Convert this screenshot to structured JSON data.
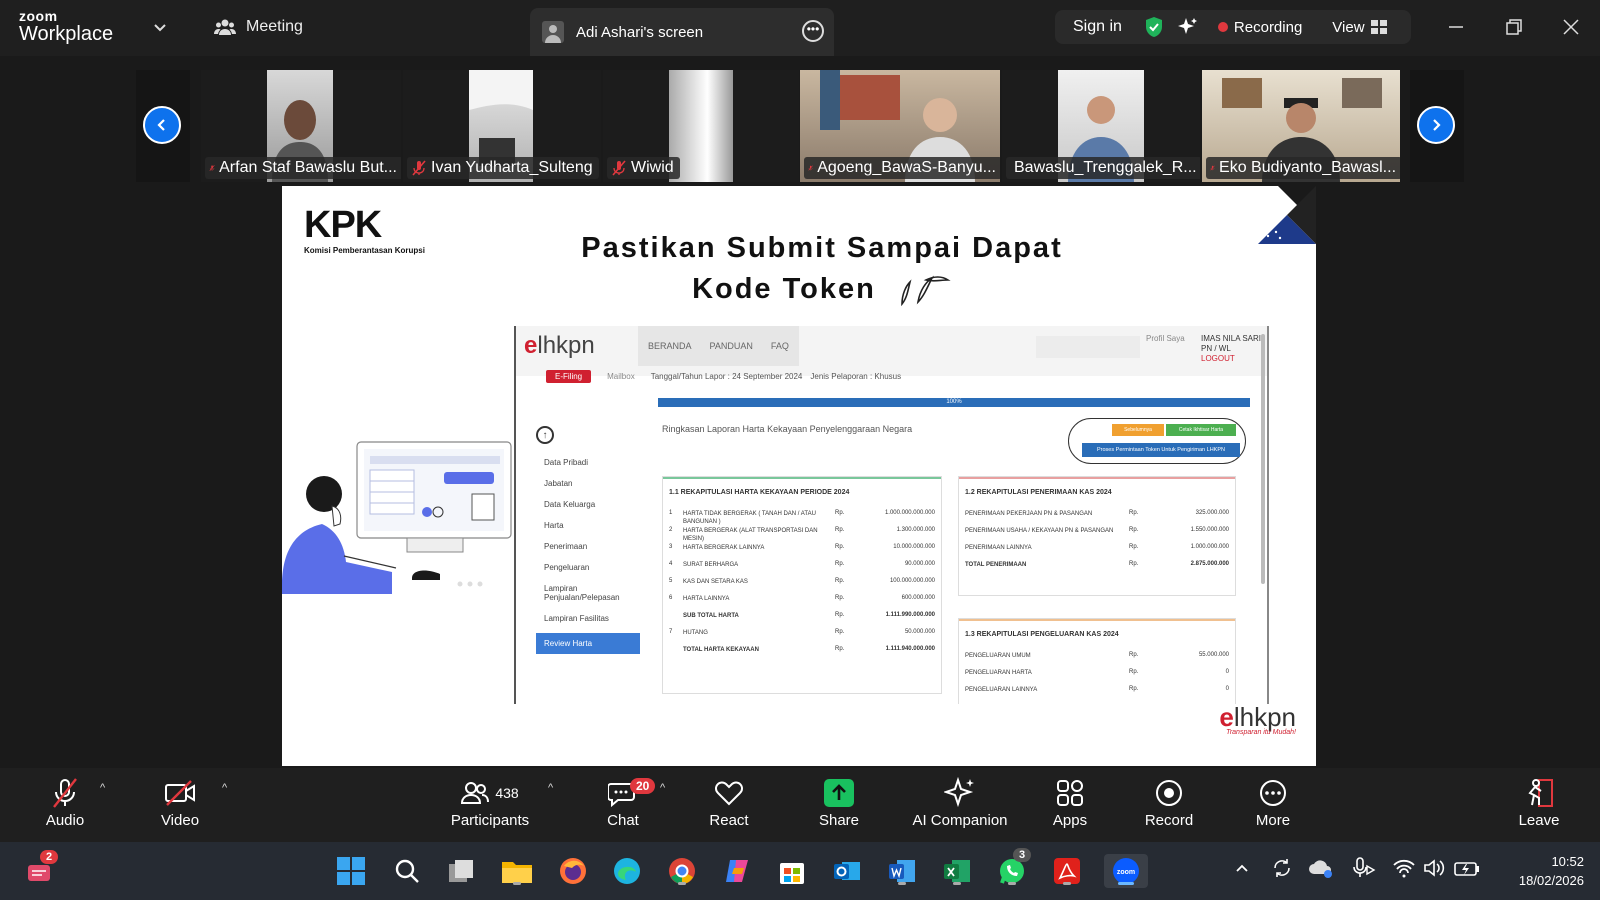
{
  "app": {
    "brand_top": "zoom",
    "brand_bottom": "Workplace"
  },
  "topbar": {
    "meeting_label": "Meeting",
    "screen_tab_label": "Adi Ashari's screen",
    "sign_in": "Sign in",
    "recording": "Recording",
    "view": "View"
  },
  "participants_strip": [
    {
      "name": "Arfan Staf Bawaslu But..."
    },
    {
      "name": "Ivan Yudharta_Sulteng"
    },
    {
      "name": "Wiwid"
    },
    {
      "name": "Agoeng_BawaS-Banyu..."
    },
    {
      "name": "Bawaslu_Trenggalek_R..."
    },
    {
      "name": "Eko Budiyanto_Bawasl..."
    }
  ],
  "slide": {
    "kpk_logo": "KPK",
    "kpk_sub": "Komisi Pemberantasan Korupsi",
    "title_line1": "Pastikan Submit Sampai Dapat",
    "title_line2": "Kode Token",
    "elhkpn_e": "e",
    "elhkpn_rest": "lhkpn",
    "elhkpn_tag": "Transparan itu Mudah!",
    "lhkpn_app": {
      "logo_e": "e",
      "logo_rest": "lhkpn",
      "menu": [
        "BERANDA",
        "PANDUAN",
        "FAQ"
      ],
      "profile": "Profil Saya",
      "user_name": "IMAS NILA SARI",
      "user_role": "PN / WL",
      "logout": "LOGOUT",
      "efiling": "E-Filing",
      "mailbox": "Mailbox",
      "tanggal": "Tanggal/Tahun Lapor : 24 September 2024",
      "jenis": "Jenis Pelaporan : Khusus",
      "progress_label": "100%",
      "progress_value": 100,
      "sidebar": [
        "Data Pribadi",
        "Jabatan",
        "Data Keluarga",
        "Harta",
        "Penerimaan",
        "Pengeluaran",
        "Lampiran Penjualan/Pelepasan",
        "Lampiran Fasilitas"
      ],
      "sidebar_active": "Review Harta",
      "ringkasan": "Ringkasan Laporan Harta Kekayaan Penyelenggaraan Negara",
      "btn_sebelumnya": "Sebelumnya",
      "btn_cetak": "Cetak Ikhtisar Harta",
      "btn_proses": "Proses Permintaan Token Untuk Pengiriman LHKPN",
      "panel1": {
        "title": "1.1 REKAPITULASI HARTA KEKAYAAN PERIODE 2024",
        "rows": [
          {
            "n": "1",
            "label": "HARTA TIDAK BERGERAK ( TANAH DAN / ATAU BANGUNAN )",
            "rp": "Rp.",
            "value": "1.000.000.000.000"
          },
          {
            "n": "2",
            "label": "HARTA BERGERAK (ALAT TRANSPORTASI DAN MESIN)",
            "rp": "Rp.",
            "value": "1.300.000.000"
          },
          {
            "n": "3",
            "label": "HARTA BERGERAK LAINNYA",
            "rp": "Rp.",
            "value": "10.000.000.000"
          },
          {
            "n": "4",
            "label": "SURAT BERHARGA",
            "rp": "Rp.",
            "value": "90.000.000"
          },
          {
            "n": "5",
            "label": "KAS DAN SETARA KAS",
            "rp": "Rp.",
            "value": "100.000.000.000"
          },
          {
            "n": "6",
            "label": "HARTA LAINNYA",
            "rp": "Rp.",
            "value": "600.000.000"
          },
          {
            "n": "",
            "label": "SUB TOTAL HARTA",
            "rp": "Rp.",
            "value": "1.111.990.000.000"
          },
          {
            "n": "7",
            "label": "HUTANG",
            "rp": "Rp.",
            "value": "50.000.000"
          },
          {
            "n": "",
            "label": "TOTAL HARTA KEKAYAAN",
            "rp": "Rp.",
            "value": "1.111.940.000.000"
          }
        ]
      },
      "panel2": {
        "title": "1.2 REKAPITULASI PENERIMAAN KAS 2024",
        "rows": [
          {
            "label": "PENERIMAAN PEKERJAAN PN & PASANGAN",
            "rp": "Rp.",
            "value": "325.000.000"
          },
          {
            "label": "PENERIMAAN USAHA / KEKAYAAN PN & PASANGAN",
            "rp": "Rp.",
            "value": "1.550.000.000"
          },
          {
            "label": "PENERIMAAN LAINNYA",
            "rp": "Rp.",
            "value": "1.000.000.000"
          },
          {
            "label": "TOTAL PENERIMAAN",
            "rp": "Rp.",
            "value": "2.875.000.000"
          }
        ]
      },
      "panel3": {
        "title": "1.3 REKAPITULASI PENGELUARAN KAS 2024",
        "rows": [
          {
            "label": "PENGELUARAN UMUM",
            "rp": "Rp.",
            "value": "55.000.000"
          },
          {
            "label": "PENGELUARAN HARTA",
            "rp": "Rp.",
            "value": "0"
          },
          {
            "label": "PENGELUARAN LAINNYA",
            "rp": "Rp.",
            "value": "0"
          }
        ]
      }
    }
  },
  "toolbar": {
    "audio": "Audio",
    "video": "Video",
    "participants": "Participants",
    "participants_count": "438",
    "chat": "Chat",
    "chat_badge": "20",
    "react": "React",
    "share": "Share",
    "ai_companion": "AI Companion",
    "apps": "Apps",
    "record": "Record",
    "more": "More",
    "leave": "Leave"
  },
  "taskbar": {
    "notification_badge": "2",
    "whatsapp_badge": "3",
    "time": "10:52",
    "date": "18/02/2026"
  },
  "colors": {
    "zoom_blue": "#0e72ed",
    "recording_red": "#e0383e",
    "share_green": "#19c15f",
    "kpk_red": "#d02030"
  }
}
